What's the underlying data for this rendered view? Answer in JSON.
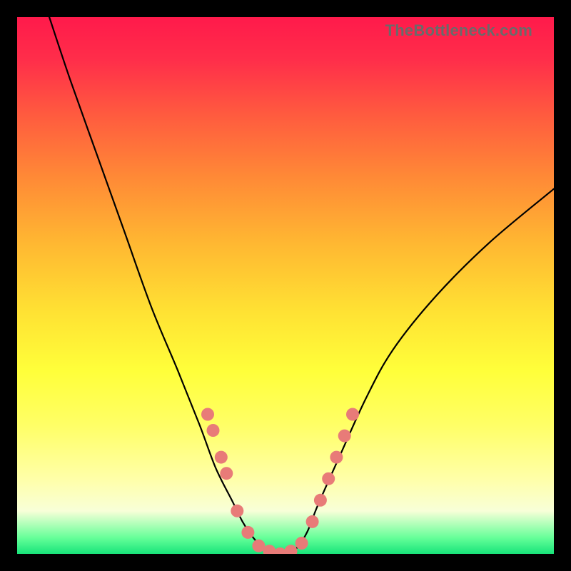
{
  "watermark": "TheBottleneck.com",
  "chart_data": {
    "type": "line",
    "title": "",
    "xlabel": "",
    "ylabel": "",
    "xlim": [
      0,
      100
    ],
    "ylim": [
      0,
      100
    ],
    "grid": false,
    "legend": false,
    "series": [
      {
        "name": "curve",
        "x": [
          6,
          10,
          15,
          20,
          25,
          30,
          34,
          37,
          40,
          42,
          44,
          46,
          48,
          50,
          52,
          54,
          56,
          60,
          65,
          70,
          78,
          88,
          100
        ],
        "y": [
          100,
          88,
          74,
          60,
          46,
          34,
          24,
          16,
          10,
          6,
          3,
          1,
          0,
          0,
          1,
          4,
          9,
          18,
          29,
          38,
          48,
          58,
          68
        ]
      }
    ],
    "markers": {
      "name": "dots",
      "color": "#e87b78",
      "x": [
        35.5,
        36.5,
        38,
        39,
        41,
        43,
        45,
        47,
        49,
        51,
        53,
        55,
        56.5,
        58,
        59.5,
        61,
        62.5
      ],
      "y": [
        26,
        23,
        18,
        15,
        8,
        4,
        1.5,
        0.5,
        0,
        0.5,
        2,
        6,
        10,
        14,
        18,
        22,
        26
      ]
    },
    "background_gradient": [
      {
        "stop": 0,
        "color": "#ff1a4b"
      },
      {
        "stop": 55,
        "color": "#ffe233"
      },
      {
        "stop": 92,
        "color": "#f8ffd8"
      },
      {
        "stop": 100,
        "color": "#18e47a"
      }
    ]
  }
}
